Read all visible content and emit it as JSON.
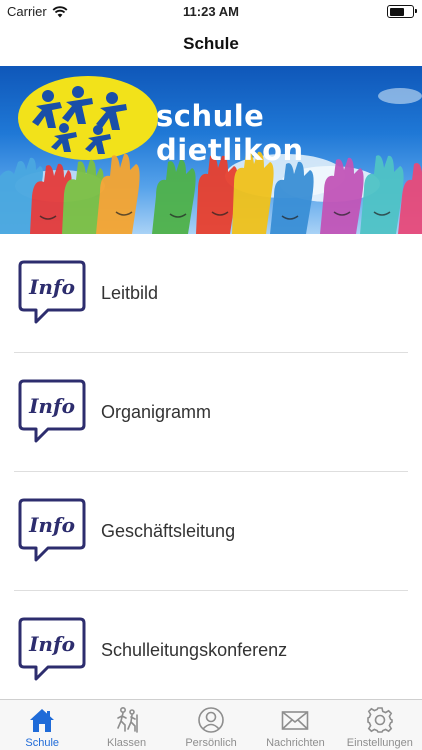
{
  "status_bar": {
    "carrier": "Carrier",
    "time": "11:23 AM",
    "battery_level": 0.65
  },
  "nav": {
    "title": "Schule"
  },
  "banner": {
    "text": "schule dietlikon"
  },
  "list": {
    "icon_text": "Info",
    "items": [
      {
        "label": "Leitbild"
      },
      {
        "label": "Organigramm"
      },
      {
        "label": "Geschäftsleitung"
      },
      {
        "label": "Schulleitungskonferenz"
      }
    ]
  },
  "tabs": [
    {
      "label": "Schule",
      "icon": "home-icon",
      "active": true
    },
    {
      "label": "Klassen",
      "icon": "hikers-icon",
      "active": false
    },
    {
      "label": "Persönlich",
      "icon": "person-icon",
      "active": false
    },
    {
      "label": "Nachrichten",
      "icon": "envelope-icon",
      "active": false
    },
    {
      "label": "Einstellungen",
      "icon": "gear-icon",
      "active": false
    }
  ],
  "colors": {
    "accent": "#1f6bd8",
    "inactive": "#8e8e8e",
    "info_navy": "#2d2d6e",
    "logo_yellow": "#f2e21a"
  }
}
